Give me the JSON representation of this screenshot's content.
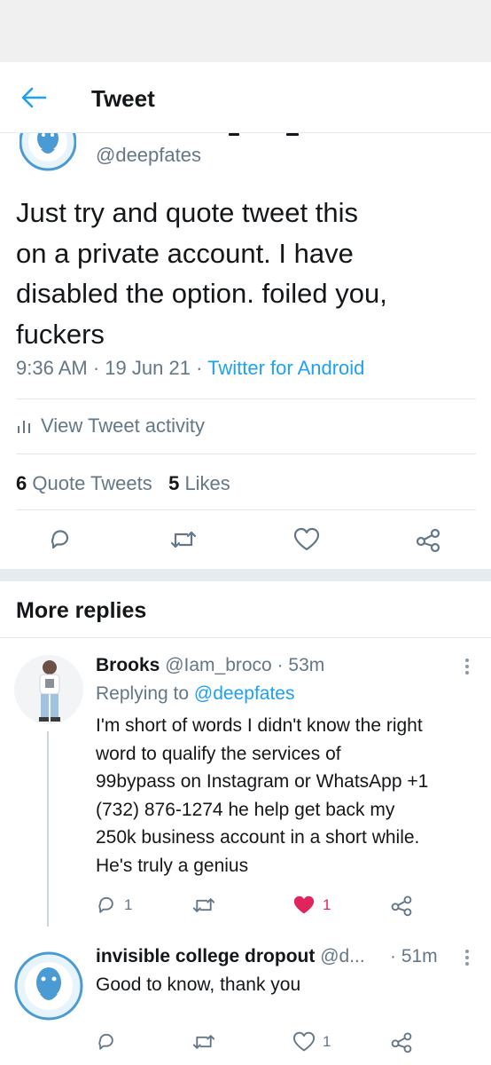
{
  "header": {
    "title": "Tweet"
  },
  "tweet": {
    "handle": "@deepfates",
    "text_lines": [
      "Just try and quote tweet this",
      "on a private account. I have",
      "disabled the option. foiled you,",
      "fuckers"
    ],
    "time": "9:36 AM",
    "date": "19 Jun 21",
    "source": "Twitter for Android",
    "sep": "·",
    "activity_label": "View Tweet activity",
    "quote_count": "6",
    "quote_label": "Quote Tweets",
    "like_count": "5",
    "like_label": "Likes"
  },
  "actions_icons": [
    "reply-icon",
    "retweet-icon",
    "like-icon",
    "share-icon"
  ],
  "more_replies_title": "More replies",
  "replies": [
    {
      "name": "Brooks",
      "handle": "@Iam_broco",
      "time": "· 53m",
      "replying_prefix": "Replying to",
      "replying_to": "@deepfates",
      "body_lines": [
        "I'm short of words I didn't know the right",
        "word to qualify the services of",
        "99bypass on Instagram or WhatsApp +1",
        "(732) 876-1274 he help get back my",
        "250k business account in a short while.",
        "He's truly a genius"
      ],
      "reply_count": "1",
      "like_count": "1",
      "liked": true
    },
    {
      "name": "invisible college dropout",
      "handle": "@d...",
      "time": "· 51m",
      "body_lines": [
        "Good to know, thank you"
      ],
      "like_count": "1",
      "liked": false
    }
  ],
  "colors": {
    "accent": "#1da1f2",
    "muted": "#657786",
    "like_red": "#e0245e",
    "text": "#14171a"
  }
}
